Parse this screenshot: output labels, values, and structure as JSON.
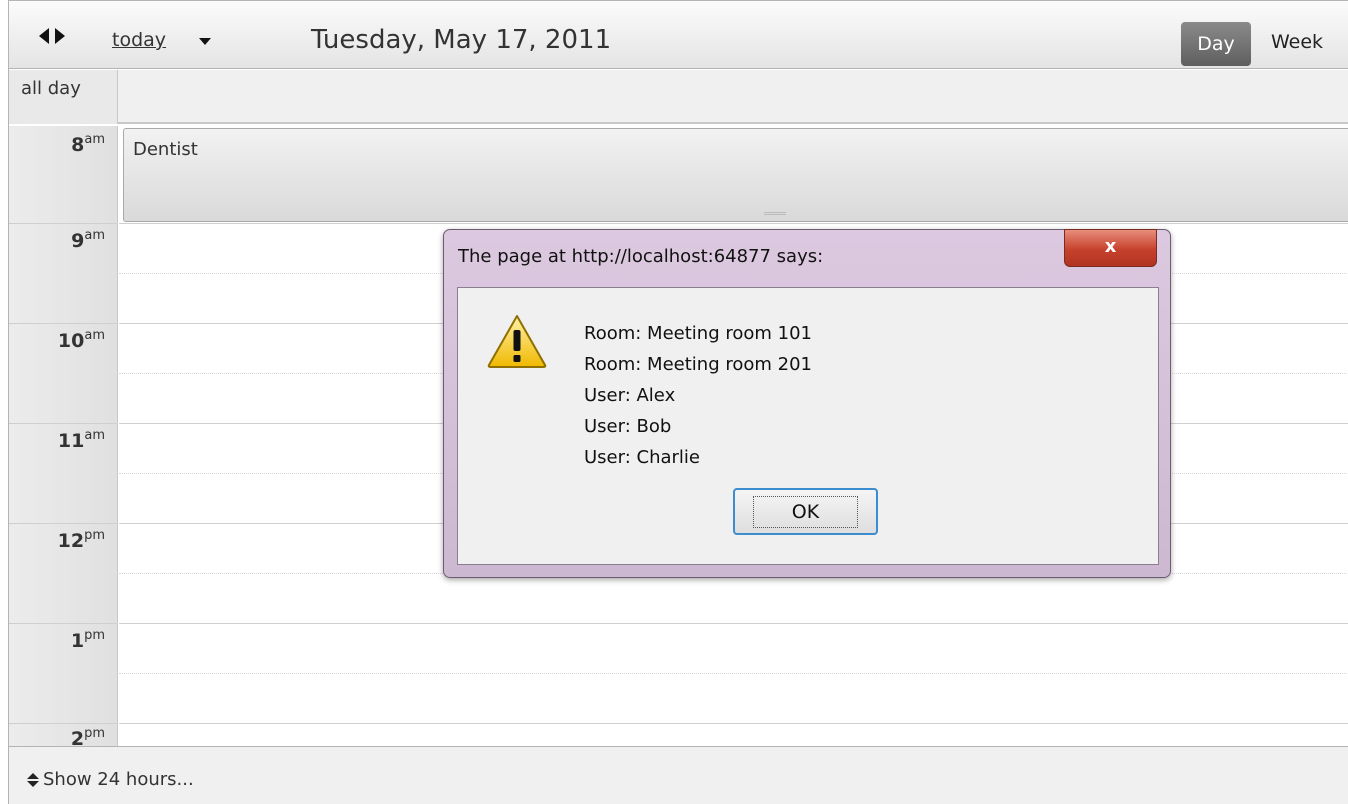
{
  "toolbar": {
    "today_label": "today",
    "date_title": "Tuesday, May 17, 2011",
    "views": {
      "day": "Day",
      "week": "Week"
    }
  },
  "allday": {
    "label": "all day"
  },
  "hours": [
    {
      "num": "8",
      "suffix": "am"
    },
    {
      "num": "9",
      "suffix": "am"
    },
    {
      "num": "10",
      "suffix": "am"
    },
    {
      "num": "11",
      "suffix": "am"
    },
    {
      "num": "12",
      "suffix": "pm"
    },
    {
      "num": "1",
      "suffix": "pm"
    },
    {
      "num": "2",
      "suffix": "pm"
    }
  ],
  "event": {
    "title": "Dentist"
  },
  "footer": {
    "show_hours_label": "Show 24 hours..."
  },
  "dialog": {
    "title": "The page at http://localhost:64877 says:",
    "close_label": "x",
    "icon": "warning-icon",
    "lines": [
      "Room: Meeting room 101",
      "Room: Meeting room 201",
      "User: Alex",
      "User: Bob",
      "User: Charlie"
    ],
    "ok_label": "OK"
  },
  "colors": {
    "day_button": "#6e6e6e",
    "close_button": "#c6412c",
    "ok_focus": "#3c8dd0"
  }
}
